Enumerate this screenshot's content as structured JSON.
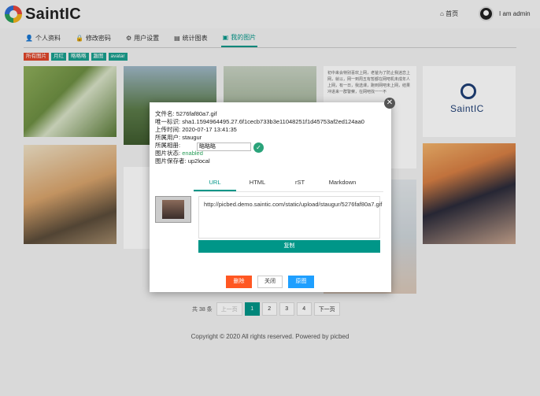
{
  "header": {
    "logo_text": "SaintIC",
    "home_label": "首页",
    "user_name": "I am admin"
  },
  "nav": {
    "items": [
      {
        "label": "个人资料",
        "icon": "user-icon"
      },
      {
        "label": "修改密码",
        "icon": "lock-icon"
      },
      {
        "label": "用户设置",
        "icon": "gear-icon"
      },
      {
        "label": "统计图表",
        "icon": "bar-chart-icon"
      },
      {
        "label": "我的图片",
        "icon": "image-icon",
        "active": true
      }
    ]
  },
  "album_tags": [
    {
      "label": "所有图片",
      "active": true
    },
    {
      "label": "月红"
    },
    {
      "label": "略略略"
    },
    {
      "label": "趣图"
    },
    {
      "label": "avatar"
    }
  ],
  "gallery": {
    "article_text": "初中来会特别喜欢上网，老爸为了防止我迷恋上网，就以，网一到周五有暂都在网吧机未成年人上网，有一日，我选课，跑到网吧未上网，结果冲进来一群警察，在网吧找一一不",
    "logo_text": "SaintIC"
  },
  "pagination": {
    "total": "共 38 条",
    "prev": "上一页",
    "pages": [
      "1",
      "2",
      "3",
      "4"
    ],
    "current": "1",
    "next": "下一页"
  },
  "footer": {
    "text": "Copyright © 2020 All rights reserved. Powered by picbed"
  },
  "modal": {
    "filename_label": "文件名:",
    "filename": "5276faf80a7.gif",
    "uid_label": "唯一标识:",
    "uid": "sha1.1594964495.27.6f1cecb733b3e11048251f1d45753af2ed124aa0",
    "upload_time_label": "上传时间:",
    "upload_time": "2020-07-17 13:41:35",
    "owner_label": "所属用户:",
    "owner": "staugur",
    "album_label": "所属相册:",
    "album_value": "略略略",
    "status_label": "图片状态:",
    "status": "enabled",
    "saver_label": "图片保存者:",
    "saver": "up2local",
    "link_tabs": [
      "URL",
      "HTML",
      "rST",
      "Markdown"
    ],
    "active_tab": "URL",
    "link": "http://picbed.demo.saintic.com/static/upload/staugur/5276faf80a7.gif",
    "copy_label": "复制",
    "delete_label": "删除",
    "close_label": "关闭",
    "source_label": "原图"
  },
  "colors": {
    "accent": "#009688",
    "danger": "#ff5722",
    "info": "#1e9fff",
    "tag_active": "#e0462a"
  }
}
